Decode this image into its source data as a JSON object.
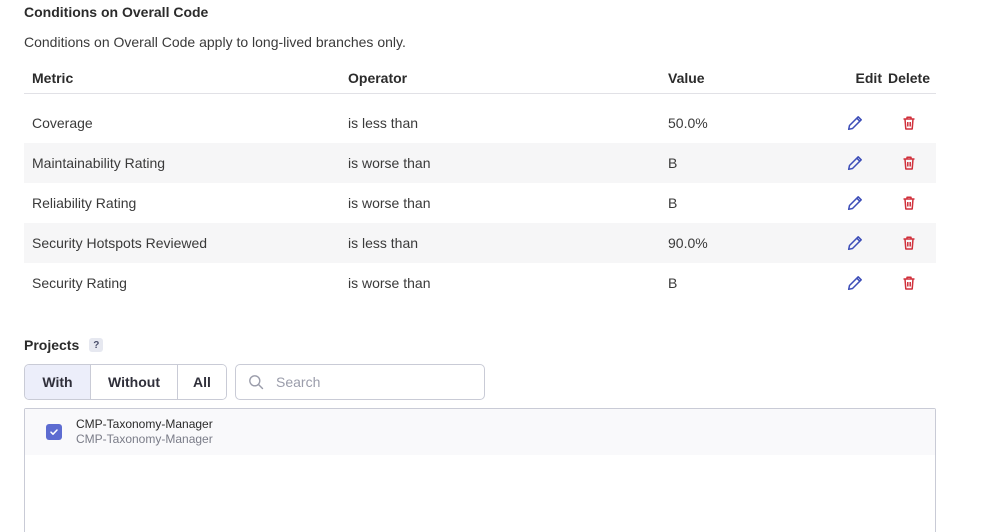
{
  "conditions": {
    "title": "Conditions on Overall Code",
    "description": "Conditions on Overall Code apply to long-lived branches only.",
    "headers": {
      "metric": "Metric",
      "operator": "Operator",
      "value": "Value",
      "edit": "Edit",
      "delete": "Delete"
    },
    "rows": [
      {
        "metric": "Coverage",
        "operator": "is less than",
        "value": "50.0%"
      },
      {
        "metric": "Maintainability Rating",
        "operator": "is worse than",
        "value": "B"
      },
      {
        "metric": "Reliability Rating",
        "operator": "is worse than",
        "value": "B"
      },
      {
        "metric": "Security Hotspots Reviewed",
        "operator": "is less than",
        "value": "90.0%"
      },
      {
        "metric": "Security Rating",
        "operator": "is worse than",
        "value": "B"
      }
    ],
    "edit_icon": "pencil-icon",
    "delete_icon": "trash-icon",
    "colors": {
      "edit": "#3d4eb8",
      "delete": "#d02f3a"
    }
  },
  "projects": {
    "title": "Projects",
    "help": "?",
    "filter": {
      "with": "With",
      "without": "Without",
      "all": "All",
      "selected": "With"
    },
    "search": {
      "placeholder": "Search",
      "value": ""
    },
    "items": [
      {
        "name": "CMP-Taxonomy-Manager",
        "key": "CMP-Taxonomy-Manager",
        "checked": true
      }
    ],
    "colors": {
      "checkbox": "#5d6cd1",
      "active_filter": "#eceefa"
    }
  }
}
